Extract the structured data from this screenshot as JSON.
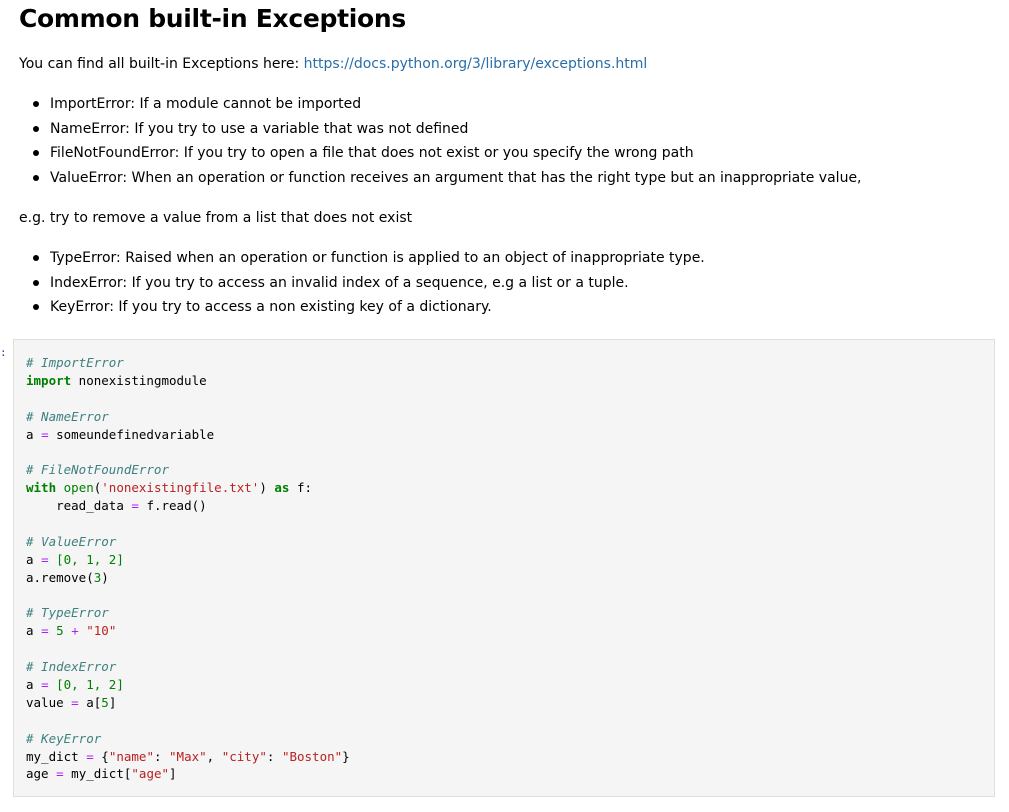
{
  "heading": "Common built-in Exceptions",
  "intro": {
    "text": "You can find all built-in Exceptions here: ",
    "link": "https://docs.python.org/3/library/exceptions.html"
  },
  "list1": [
    "ImportError: If a module cannot be imported",
    "NameError: If you try to use a variable that was not defined",
    "FileNotFoundError: If you try to open a file that does not exist or you specify the wrong path",
    "ValueError: When an operation or function receives an argument that has the right type but an inappropriate value,"
  ],
  "note": "e.g. try to remove a value from a list that does not exist",
  "list2": [
    "TypeError: Raised when an operation or function is applied to an object of inappropriate type.",
    "IndexError: If you try to access an invalid index of a sequence, e.g a list or a tuple.",
    "KeyError: If you try to access a non existing key of a dictionary."
  ],
  "prompt": ":",
  "code": {
    "c_import": "# ImportError",
    "kw_import": "import",
    "mod": " nonexistingmodule",
    "c_name": "# NameError",
    "name_a": "a",
    "eq": "=",
    "undef": "someundefinedvariable",
    "c_file": "# FileNotFoundError",
    "kw_with": "with",
    "open": "open",
    "file_str": "'nonexistingfile.txt'",
    "kw_as": "as",
    "f": "f:",
    "indent": "    ",
    "read_data": "read_data",
    "fread": "f.read",
    "c_value": "# ValueError",
    "list_val": "[0, 1, 2]",
    "a_remove": "a.remove",
    "three": "3",
    "c_type": "# TypeError",
    "five": "5",
    "plus": "+",
    "ten_str": "\"10\"",
    "c_index": "# IndexError",
    "value": "value",
    "a_idx": "a",
    "five_idx": "5",
    "c_key": "# KeyError",
    "my_dict": "my_dict",
    "name_key": "\"name\"",
    "max_str": "\"Max\"",
    "city_key": "\"city\"",
    "boston_str": "\"Boston\"",
    "age": "age",
    "my_dict2": "my_dict",
    "age_key": "\"age\""
  }
}
